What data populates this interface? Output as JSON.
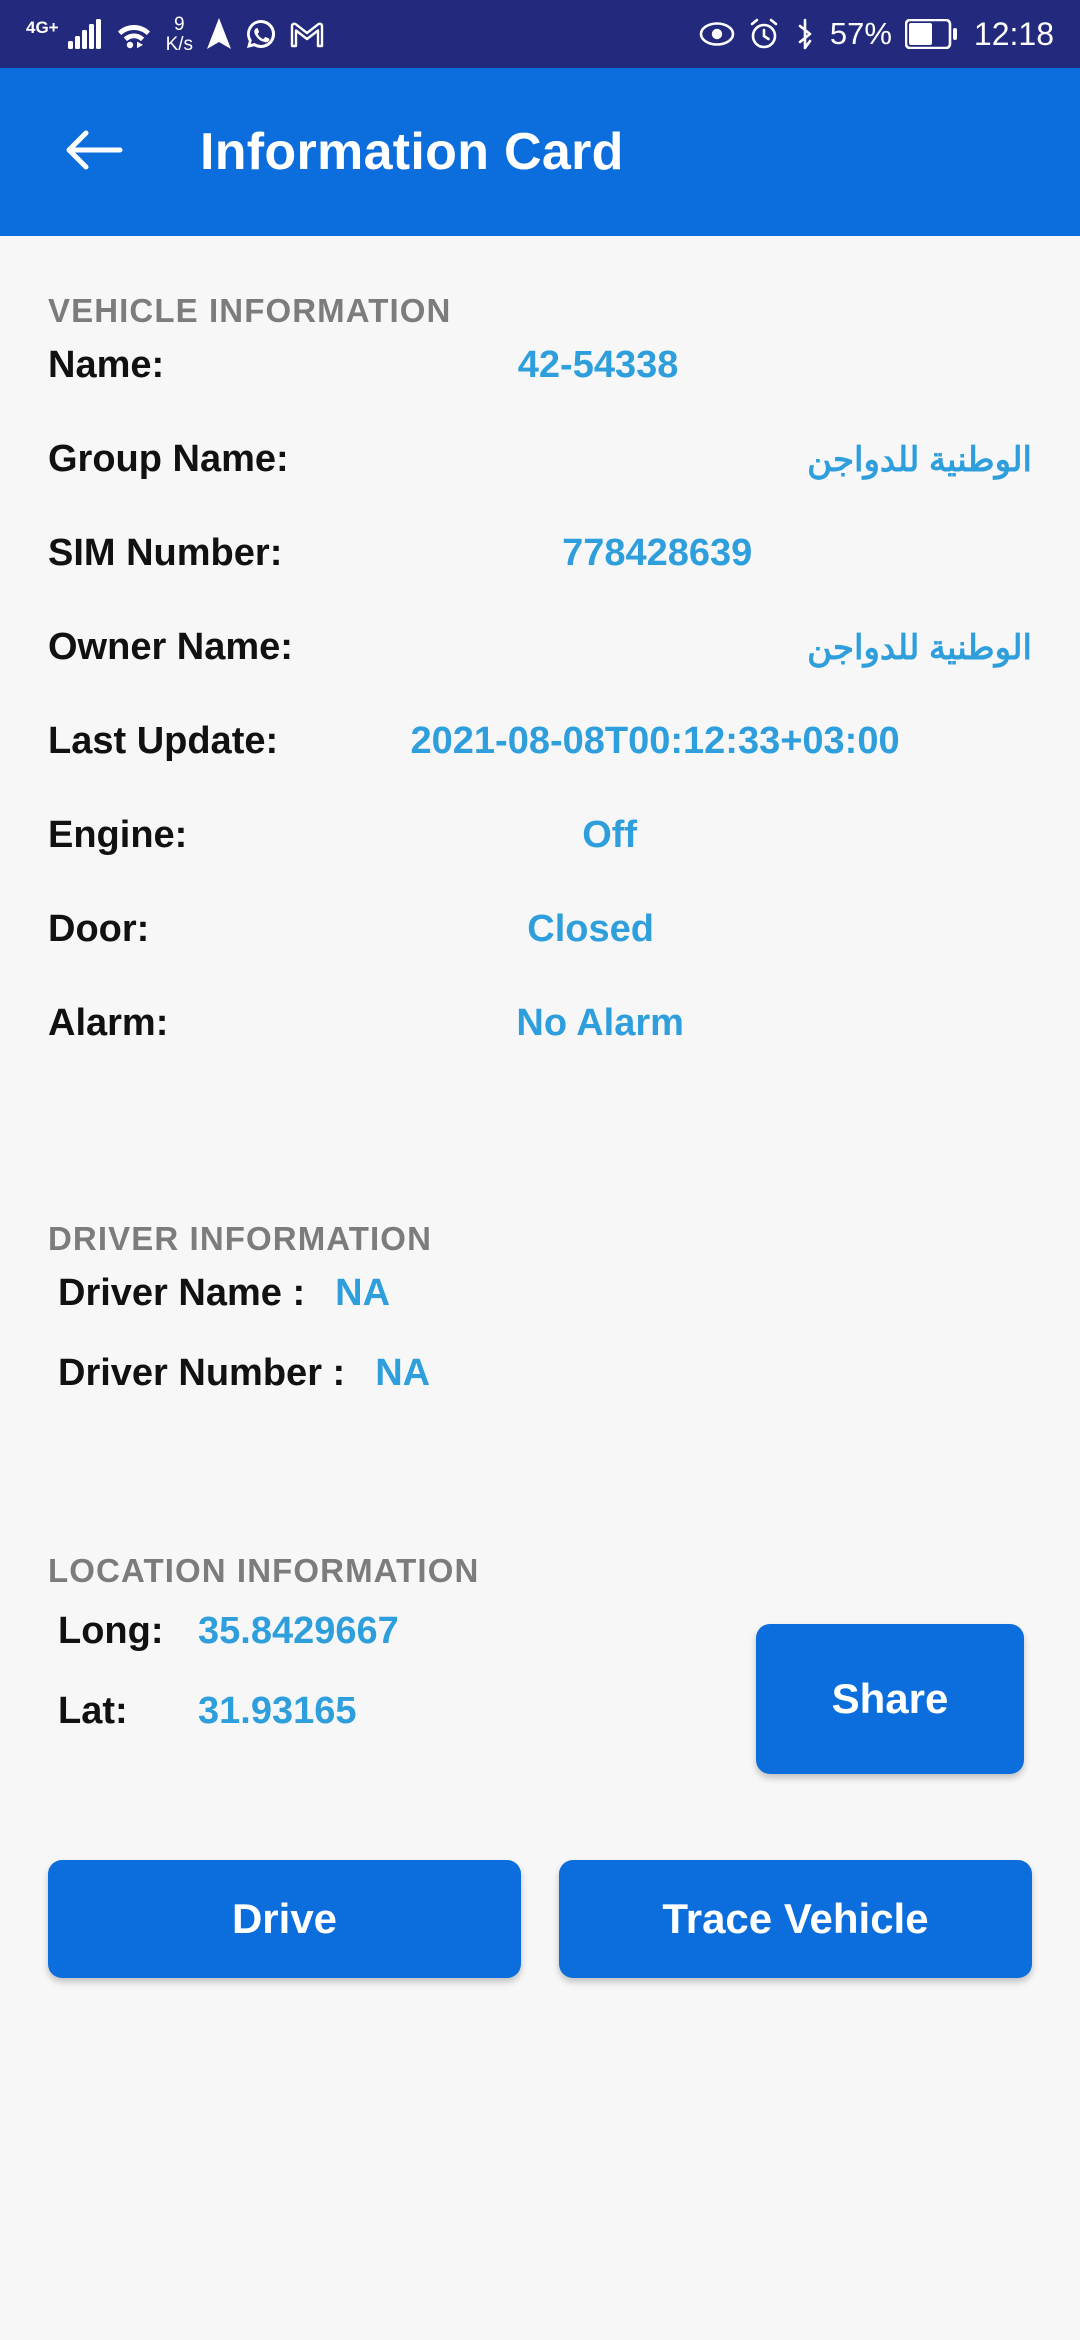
{
  "status_bar": {
    "network_type": "4G+",
    "data_rate_value": "9",
    "data_rate_unit": "K/s",
    "battery_percent": "57%",
    "time": "12:18",
    "icons": [
      "signal-icon",
      "wifi-icon",
      "navigation-icon",
      "whatsapp-icon",
      "gmail-icon",
      "eye-icon",
      "alarm-icon",
      "bluetooth-icon",
      "battery-icon"
    ]
  },
  "app_bar": {
    "back_icon": "arrow-left-icon",
    "title": "Information Card"
  },
  "colors": {
    "status_bar": "#23297C",
    "app_bar": "#0B6EDC",
    "accent_value": "#2E9FDC",
    "button": "#0B6EDC",
    "background": "#F7F7F7",
    "section_header": "#7C7C7C"
  },
  "vehicle_section": {
    "title": "VEHICLE INFORMATION",
    "rows": [
      {
        "label": "Name:",
        "value": "42-54338",
        "rtl": false
      },
      {
        "label": "Group Name:",
        "value": "الوطنية للدواجن",
        "rtl": true
      },
      {
        "label": "SIM Number:",
        "value": "778428639",
        "rtl": false
      },
      {
        "label": "Owner Name:",
        "value": "الوطنية للدواجن",
        "rtl": true
      },
      {
        "label": "Last Update:",
        "value": "2021-08-08T00:12:33+03:00",
        "rtl": false
      },
      {
        "label": "Engine:",
        "value": "Off",
        "rtl": false
      },
      {
        "label": "Door:",
        "value": "Closed",
        "rtl": false
      },
      {
        "label": "Alarm:",
        "value": "No Alarm",
        "rtl": false
      }
    ]
  },
  "driver_section": {
    "title": "DRIVER INFORMATION",
    "rows": [
      {
        "label": "Driver Name :",
        "value": "NA"
      },
      {
        "label": "Driver Number :",
        "value": "NA"
      }
    ]
  },
  "location_section": {
    "title": "LOCATION INFORMATION",
    "rows": [
      {
        "label": "Long:",
        "value": "35.8429667"
      },
      {
        "label": "Lat:",
        "value": "31.93165"
      }
    ],
    "share_label": "Share"
  },
  "actions": {
    "drive_label": "Drive",
    "trace_label": "Trace Vehicle"
  }
}
